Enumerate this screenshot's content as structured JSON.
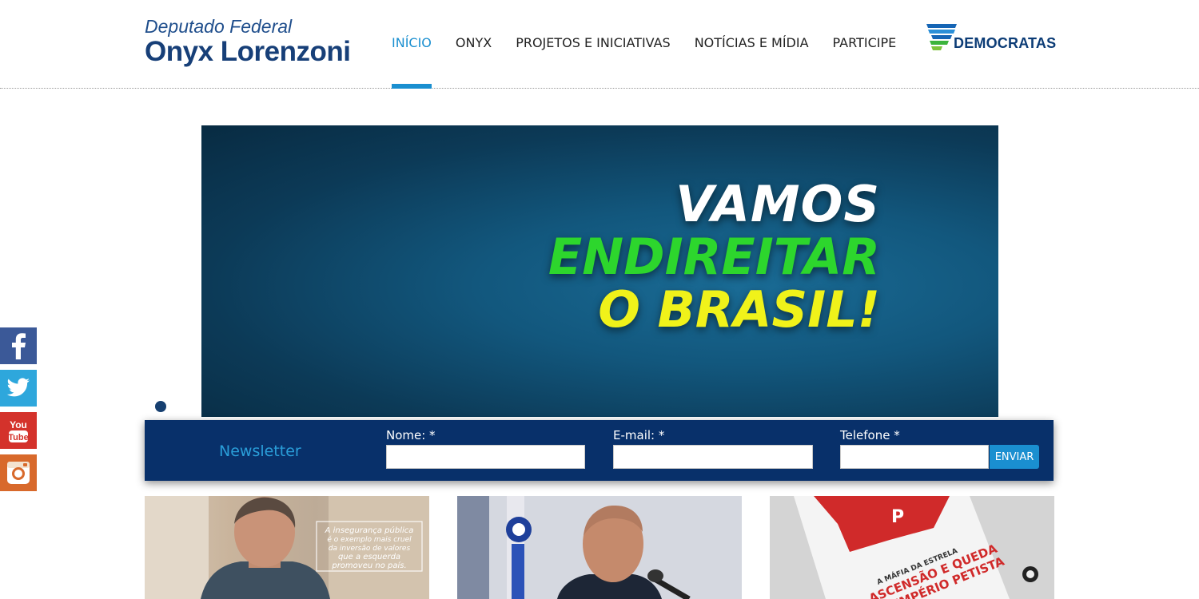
{
  "header": {
    "logo_subtitle": "Deputado Federal",
    "logo_title": "Onyx Lorenzoni",
    "party_name": "DEMOCRATAS"
  },
  "nav": {
    "items": [
      {
        "label": "INÍCIO",
        "active": true
      },
      {
        "label": "ONYX",
        "active": false
      },
      {
        "label": "PROJETOS E INICIATIVAS",
        "active": false
      },
      {
        "label": "NOTÍCIAS E MÍDIA",
        "active": false
      },
      {
        "label": "PARTICIPE",
        "active": false
      }
    ],
    "accent_color": "#1a8fd0"
  },
  "banner": {
    "line1": "VAMOS",
    "line2": "ENDIREITAR",
    "line3": "O BRASIL!",
    "colors": {
      "line1": "#ffffff",
      "line2": "#2dd62d",
      "line3": "#f0f21a"
    }
  },
  "social": [
    "facebook-icon",
    "twitter-icon",
    "youtube-icon",
    "instagram-icon"
  ],
  "newsletter": {
    "title": "Newsletter",
    "fields": [
      {
        "label": "Nome: *",
        "value": ""
      },
      {
        "label": "E-mail: *",
        "value": ""
      },
      {
        "label": "Telefone *",
        "value": ""
      }
    ],
    "submit_label": "ENVIAR",
    "background_color": "#08306a"
  },
  "thumbnails": {
    "quote": [
      "A insegurança pública",
      "é o exemplo mais cruel",
      "da inversão de valores",
      "que a esquerda",
      "promoveu no país."
    ],
    "book_kicker": "A MÁFIA DA ESTRELA",
    "book_title_1": "ASCENSÃO E QUEDA",
    "book_title_2": "DO IMPÉRIO PETISTA",
    "book_letter": "P"
  }
}
